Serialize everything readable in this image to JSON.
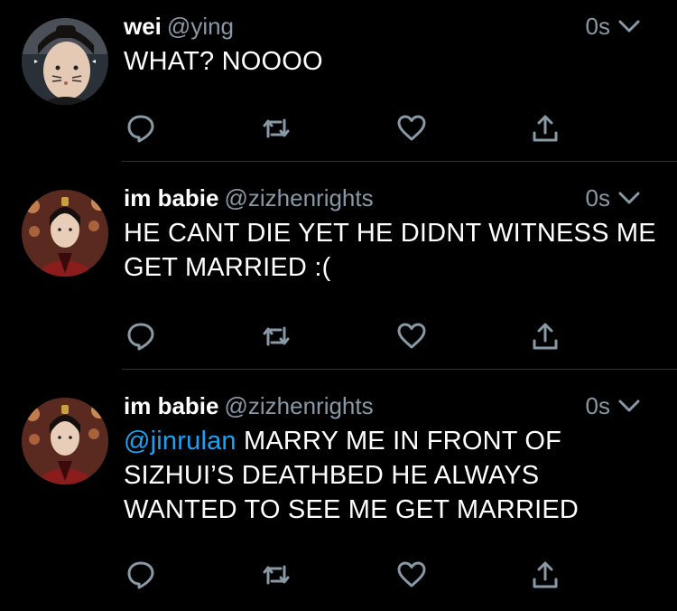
{
  "colors": {
    "background": "#000000",
    "text": "#ffffff",
    "secondary": "#8899a6",
    "link": "#1da1f2",
    "divider": "#2f3336"
  },
  "tweets": [
    {
      "name": "wei",
      "handle": "@ying",
      "time": "0s",
      "text_mention": "",
      "text": "WHAT? NOOOO",
      "avatar": "avatar-wei"
    },
    {
      "name": "im babie",
      "handle": "@zizhenrights",
      "time": "0s",
      "text_mention": "",
      "text": "HE CANT DIE YET HE DIDNT WITNESS ME GET MARRIED :(",
      "avatar": "avatar-im-babie"
    },
    {
      "name": "im babie",
      "handle": "@zizhenrights",
      "time": "0s",
      "text_mention": "@jinrulan",
      "text": " MARRY ME IN FRONT OF SIZHUI’S DEATHBED HE ALWAYS WANTED TO SEE ME GET MARRIED",
      "avatar": "avatar-im-babie"
    }
  ],
  "icons": {
    "more": "chevron-down-icon",
    "reply": "reply-icon",
    "retweet": "retweet-icon",
    "like": "heart-icon",
    "share": "share-icon"
  }
}
